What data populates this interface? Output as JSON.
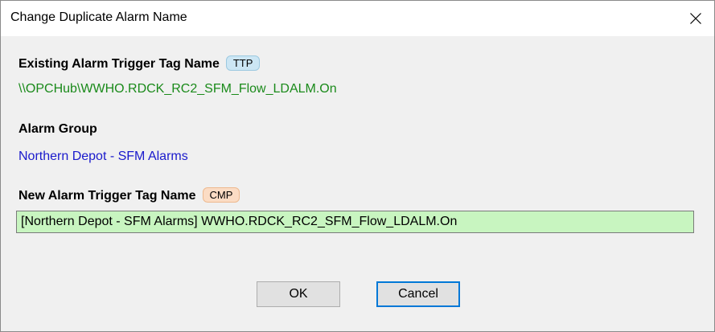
{
  "window": {
    "title": "Change Duplicate Alarm Name",
    "close_glyph": "close-icon"
  },
  "existing": {
    "label": "Existing Alarm Trigger Tag Name",
    "badge": "TTP",
    "value": "\\\\OPCHub\\WWHO.RDCK_RC2_SFM_Flow_LDALM.On"
  },
  "group": {
    "label": "Alarm Group",
    "value": "Northern Depot - SFM Alarms"
  },
  "new_tag": {
    "label": "New Alarm Trigger Tag Name",
    "badge": "CMP",
    "value": "[Northern Depot - SFM Alarms] WWHO.RDCK_RC2_SFM_Flow_LDALM.On"
  },
  "buttons": {
    "ok": "OK",
    "cancel": "Cancel"
  },
  "colors": {
    "existing_value": "#1a8a1a",
    "group_value": "#1a1acc",
    "input_bg": "#c8f5c0",
    "ttp_badge": "#cce6f4",
    "cmp_badge": "#fbdcc4",
    "focus_border": "#0078d7"
  }
}
